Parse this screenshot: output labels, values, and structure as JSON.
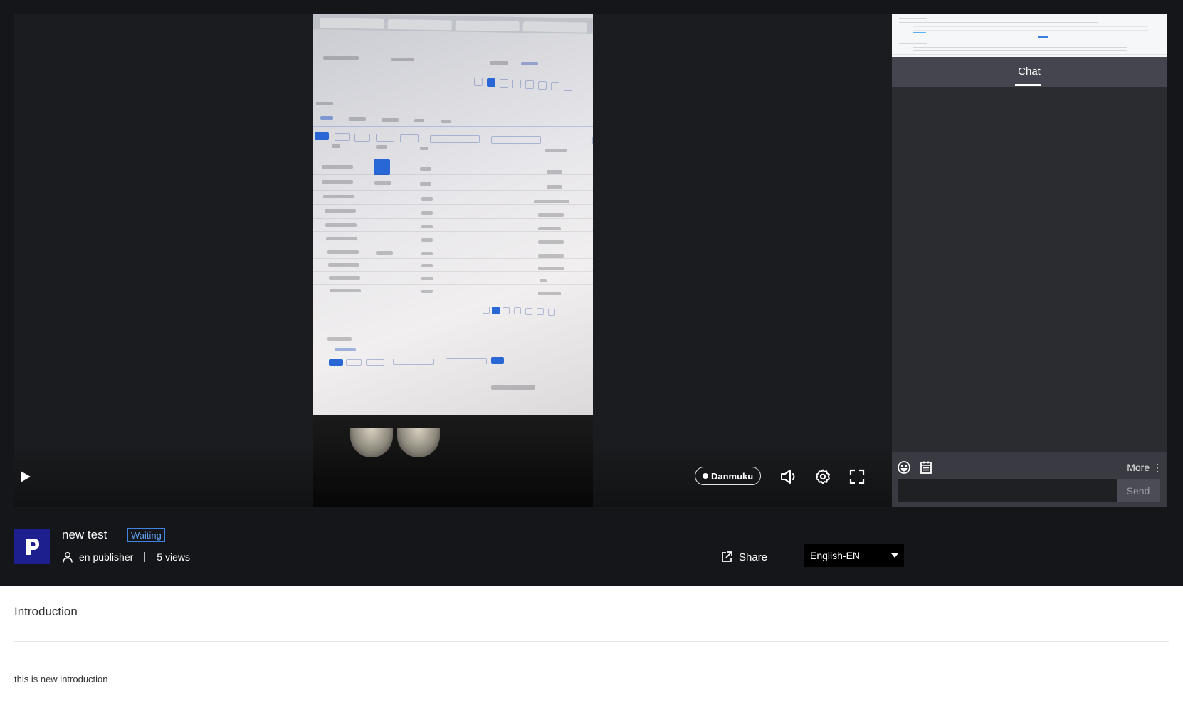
{
  "player": {
    "danmuku_label": "Danmuku",
    "icons": [
      "play-icon",
      "volume-icon",
      "gear-icon",
      "fullscreen-icon"
    ]
  },
  "chat": {
    "tab_label": "Chat",
    "more_label": "More",
    "input_value": "",
    "send_label": "Send",
    "icons": [
      "emoji-icon",
      "notes-icon",
      "more-dots-icon"
    ]
  },
  "stream": {
    "title": "new test",
    "status": "Waiting",
    "publisher": "en publisher",
    "views": "5 views",
    "share_label": "Share",
    "language": "English-EN"
  },
  "intro": {
    "heading": "Introduction",
    "text": "this is new introduction"
  },
  "colors": {
    "background_dark": "#15161a",
    "accent_blue": "#3f84e5",
    "logo_bg": "#1e1f8f"
  }
}
